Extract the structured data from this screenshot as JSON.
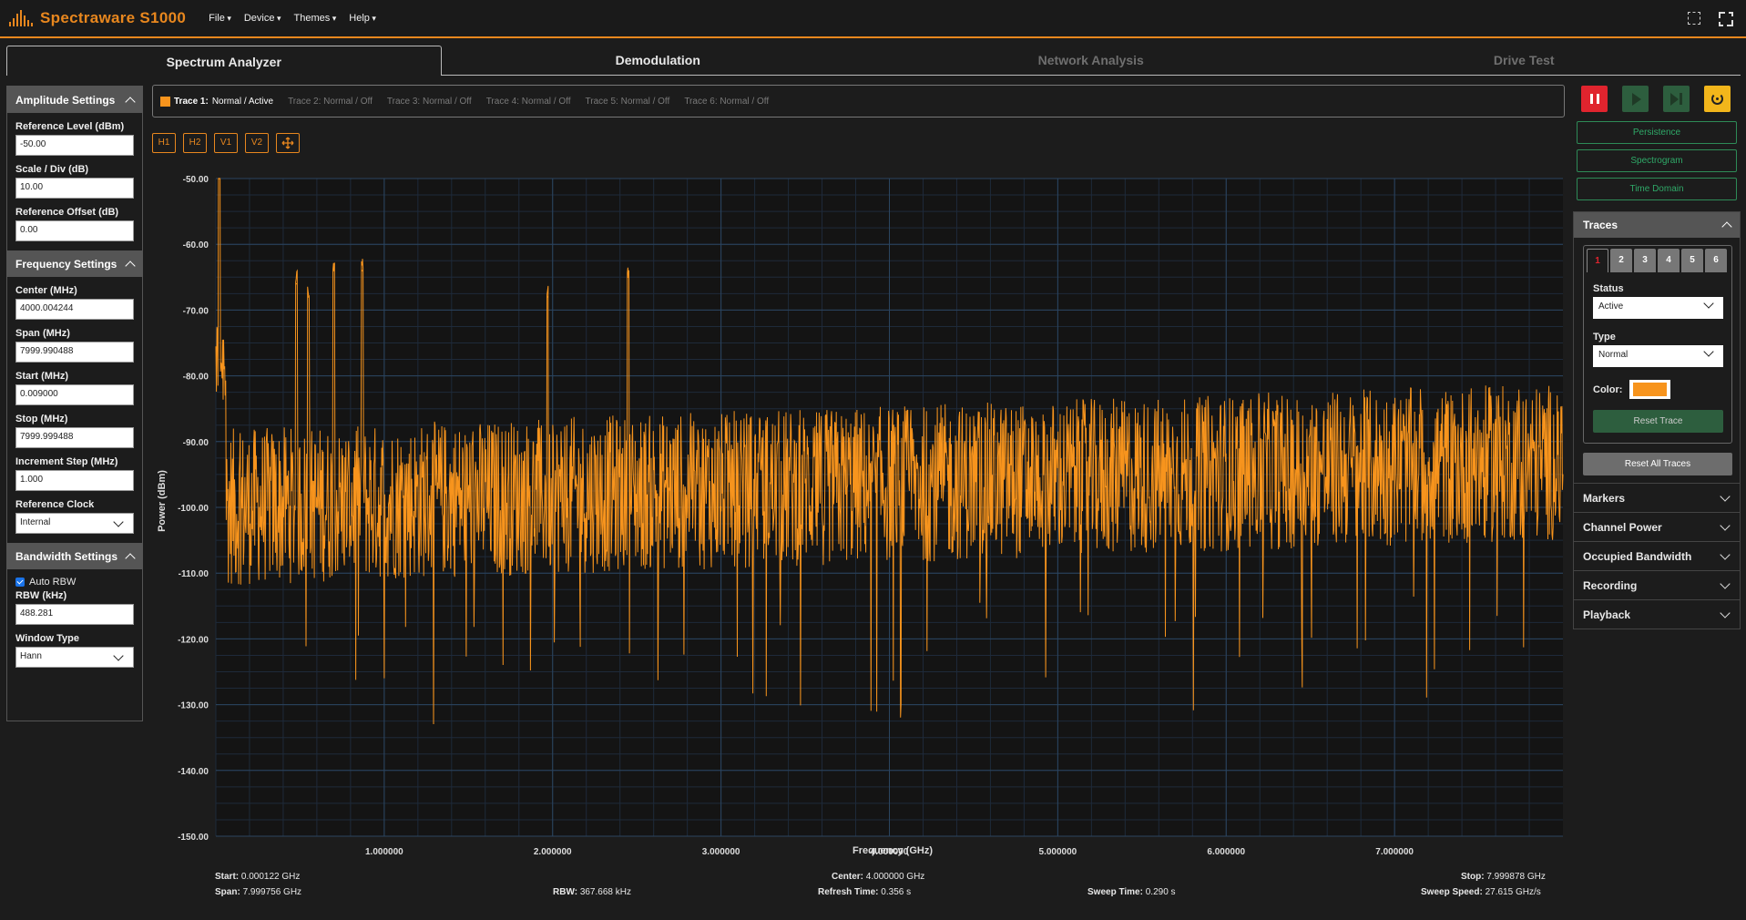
{
  "app": {
    "title": "Spectraware S1000"
  },
  "menu": [
    "File",
    "Device",
    "Themes",
    "Help"
  ],
  "tabs": [
    "Spectrum Analyzer",
    "Demodulation",
    "Network Analysis",
    "Drive Test"
  ],
  "amplitude": {
    "title": "Amplitude Settings",
    "ref_level_label": "Reference Level (dBm)",
    "ref_level": "-50.00",
    "scale_label": "Scale / Div (dB)",
    "scale": "10.00",
    "offset_label": "Reference Offset (dB)",
    "offset": "0.00"
  },
  "frequency": {
    "title": "Frequency Settings",
    "center_label": "Center (MHz)",
    "center": "4000.004244",
    "span_label": "Span (MHz)",
    "span": "7999.990488",
    "start_label": "Start (MHz)",
    "start": "0.009000",
    "stop_label": "Stop (MHz)",
    "stop": "7999.999488",
    "step_label": "Increment Step (MHz)",
    "step": "1.000",
    "clock_label": "Reference Clock",
    "clock": "Internal"
  },
  "bandwidth": {
    "title": "Bandwidth Settings",
    "auto_rbw": "Auto RBW",
    "rbw_label": "RBW (kHz)",
    "rbw": "488.281",
    "window_label": "Window Type",
    "window": "Hann"
  },
  "trace_bar": [
    {
      "name": "Trace 1:",
      "state": "Normal / Active"
    },
    {
      "name": "Trace 2:",
      "state": "Normal / Off"
    },
    {
      "name": "Trace 3:",
      "state": "Normal / Off"
    },
    {
      "name": "Trace 4:",
      "state": "Normal / Off"
    },
    {
      "name": "Trace 5:",
      "state": "Normal / Off"
    },
    {
      "name": "Trace 6:",
      "state": "Normal / Off"
    }
  ],
  "marker_buttons": [
    "H1",
    "H2",
    "V1",
    "V2"
  ],
  "modes": [
    "Persistence",
    "Spectrogram",
    "Time Domain"
  ],
  "traces_panel": {
    "title": "Traces",
    "numbers": [
      "1",
      "2",
      "3",
      "4",
      "5",
      "6"
    ],
    "status_label": "Status",
    "status": "Active",
    "type_label": "Type",
    "type": "Normal",
    "color_label": "Color:",
    "color": "#f7941d",
    "reset_trace": "Reset Trace",
    "reset_all": "Reset All Traces"
  },
  "accordions": [
    "Markers",
    "Channel Power",
    "Occupied Bandwidth",
    "Recording",
    "Playback"
  ],
  "status": {
    "start_label": "Start:",
    "start": "0.000122 GHz",
    "span_label": "Span:",
    "span": "7.999756 GHz",
    "rbw_label": "RBW:",
    "rbw": "367.668 kHz",
    "center_label": "Center:",
    "center": "4.000000 GHz",
    "refresh_label": "Refresh Time:",
    "refresh": "0.356 s",
    "sweep_label": "Sweep Time:",
    "sweep": "0.290 s",
    "stop_label": "Stop:",
    "stop": "7.999878 GHz",
    "speed_label": "Sweep Speed:",
    "speed": "27.615 GHz/s"
  },
  "chart_data": {
    "type": "line",
    "xlabel": "Frequency (GHz)",
    "ylabel": "Power (dBm)",
    "xlim": [
      0.000122,
      7.999878
    ],
    "ylim": [
      -150,
      -50
    ],
    "x_ticks": [
      "1.000000",
      "2.000000",
      "3.000000",
      "4.000000",
      "5.000000",
      "6.000000",
      "7.000000"
    ],
    "y_ticks": [
      "-50.00",
      "-60.00",
      "-70.00",
      "-80.00",
      "-90.00",
      "-100.00",
      "-110.00",
      "-120.00",
      "-130.00",
      "-140.00",
      "-150.00"
    ],
    "grid": true,
    "series": [
      {
        "color": "#f7941d",
        "noise_floor_start": -100,
        "noise_floor_end": -93,
        "peaks": [
          {
            "x": 0.02,
            "y": -50
          },
          {
            "x": 0.48,
            "y": -66
          },
          {
            "x": 0.55,
            "y": -68
          },
          {
            "x": 0.7,
            "y": -64
          },
          {
            "x": 0.87,
            "y": -64
          },
          {
            "x": 1.97,
            "y": -68
          },
          {
            "x": 2.45,
            "y": -65
          }
        ]
      }
    ]
  }
}
